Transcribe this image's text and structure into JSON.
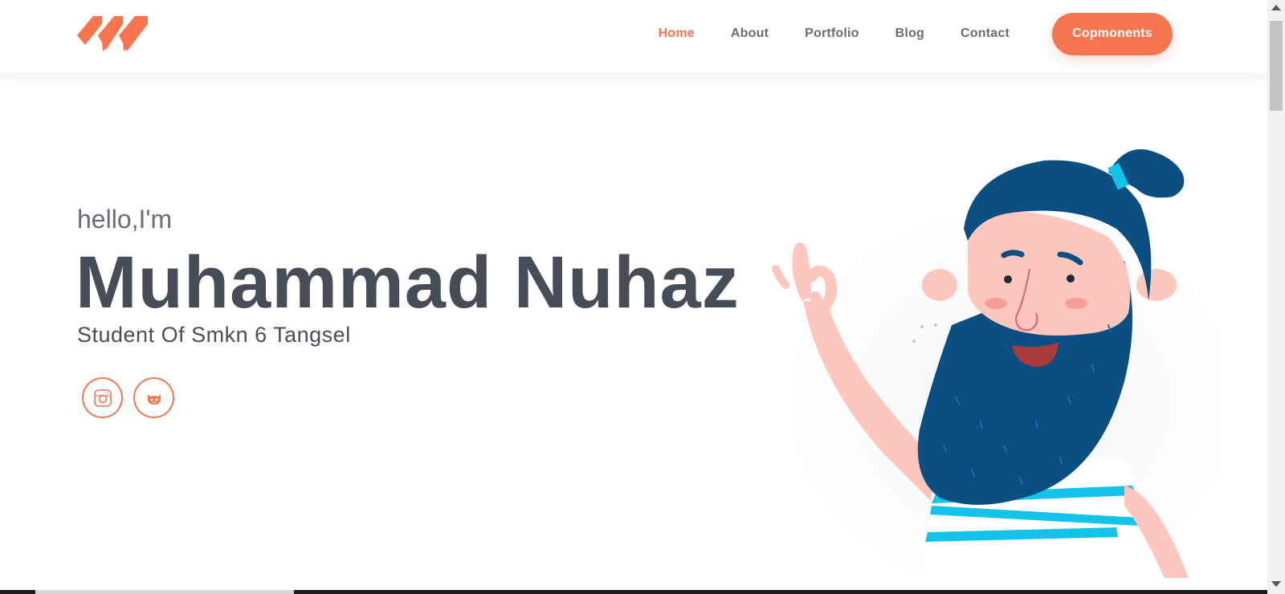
{
  "nav": {
    "items": [
      "Home",
      "About",
      "Portfolio",
      "Blog",
      "Contact"
    ],
    "active": "Home",
    "cta_label": "Copmonents"
  },
  "hero": {
    "greeting": "hello,I'm",
    "name": "Muhammad Nuhaz",
    "subtitle": "Student Of Smkn 6 Tangsel"
  },
  "social": [
    "instagram-icon",
    "github-icon"
  ],
  "colors": {
    "accent": "#f7764f",
    "heading": "#464d56",
    "text": "#6a6d74",
    "hair": "#094f82",
    "skin": "#fdc7be",
    "stripe": "#12c4ea"
  }
}
